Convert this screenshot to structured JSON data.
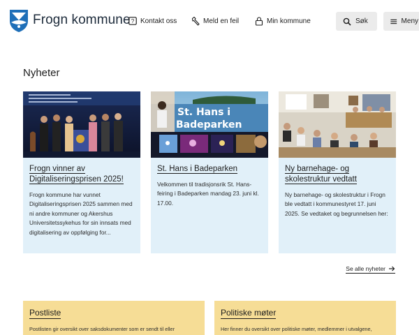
{
  "header": {
    "site_title": "Frogn kommune",
    "nav": [
      {
        "label": "Kontakt oss",
        "icon": "question-box-icon"
      },
      {
        "label": "Meld en feil",
        "icon": "wrench-icon"
      },
      {
        "label": "Min kommune",
        "icon": "lock-icon"
      }
    ],
    "search_label": "Søk",
    "menu_label": "Meny"
  },
  "news": {
    "heading": "Nyheter",
    "articles": [
      {
        "title": "Frogn vinner av Digitaliseringsprisen 2025!",
        "text": "Frogn kommune har vunnet Digitaliseringsprisen 2025 sammen med ni andre kommuner og Akershus Universitetssykehus for sin innsats med digitalisering av oppfølging for..."
      },
      {
        "title": "St. Hans i Badeparken",
        "text": "Velkommen til tradisjonsrik St. Hans-feiring i Badeparken mandag 23. juni kl. 17.00.",
        "image_text": "St. Hans i Badeparken"
      },
      {
        "title": "Ny barnehage- og skolestruktur vedtatt",
        "text": "Ny barnehage- og skolestruktur i Frogn ble vedtatt i kommunestyret 17. juni 2025. Se vedtaket og begrunnelsen her:"
      }
    ],
    "see_all": "Se alle nyheter"
  },
  "panels": [
    {
      "title": "Postliste",
      "text": "Postlisten gir oversikt over saksdokumenter som er sendt til eller"
    },
    {
      "title": "Politiske møter",
      "text": "Her finner du oversikt over politiske møter, medlemmer i utvalgene,"
    }
  ],
  "colors": {
    "card_bg": "#e1f0f9",
    "panel_bg": "#f6dd96",
    "logo_blue": "#1f6fb8",
    "button_bg": "#ebebeb"
  }
}
